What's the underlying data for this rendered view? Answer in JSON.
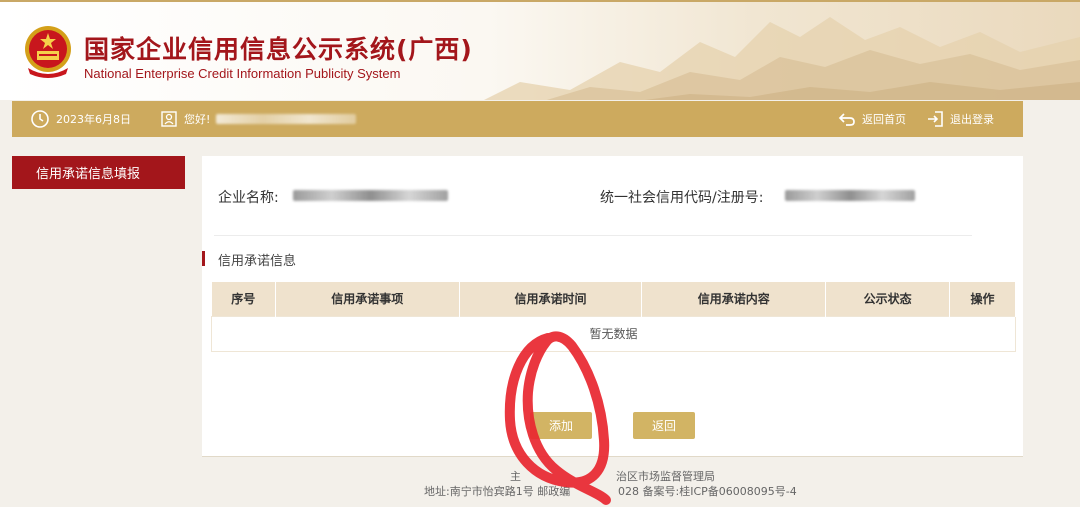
{
  "header": {
    "title_cn": "国家企业信用信息公示系统(广西)",
    "title_en": "National Enterprise Credit Information Publicity System"
  },
  "navbar": {
    "date": "2023年6月8日",
    "greeting": "您好!",
    "home_label": "返回首页",
    "logout_label": "退出登录"
  },
  "sidebar": {
    "items": [
      {
        "label": "信用承诺信息填报"
      }
    ]
  },
  "company": {
    "name_label": "企业名称:",
    "code_label": "统一社会信用代码/注册号:"
  },
  "section": {
    "title": "信用承诺信息"
  },
  "table": {
    "columns": [
      "序号",
      "信用承诺事项",
      "信用承诺时间",
      "信用承诺内容",
      "公示状态",
      "操作"
    ],
    "empty_text": "暂无数据"
  },
  "actions": {
    "add_label": "添加",
    "back_label": "返回"
  },
  "footer": {
    "line1_start": "主",
    "line1_end": "治区市场监督管理局",
    "line2_start": "地址:南宁市怡宾路1号 邮政编",
    "line2_end": "028   备案号:桂ICP备06008095号-4"
  },
  "colors": {
    "brand_red": "#a3161b",
    "gold": "#cdaa5e",
    "annotation": "#e8262f"
  }
}
